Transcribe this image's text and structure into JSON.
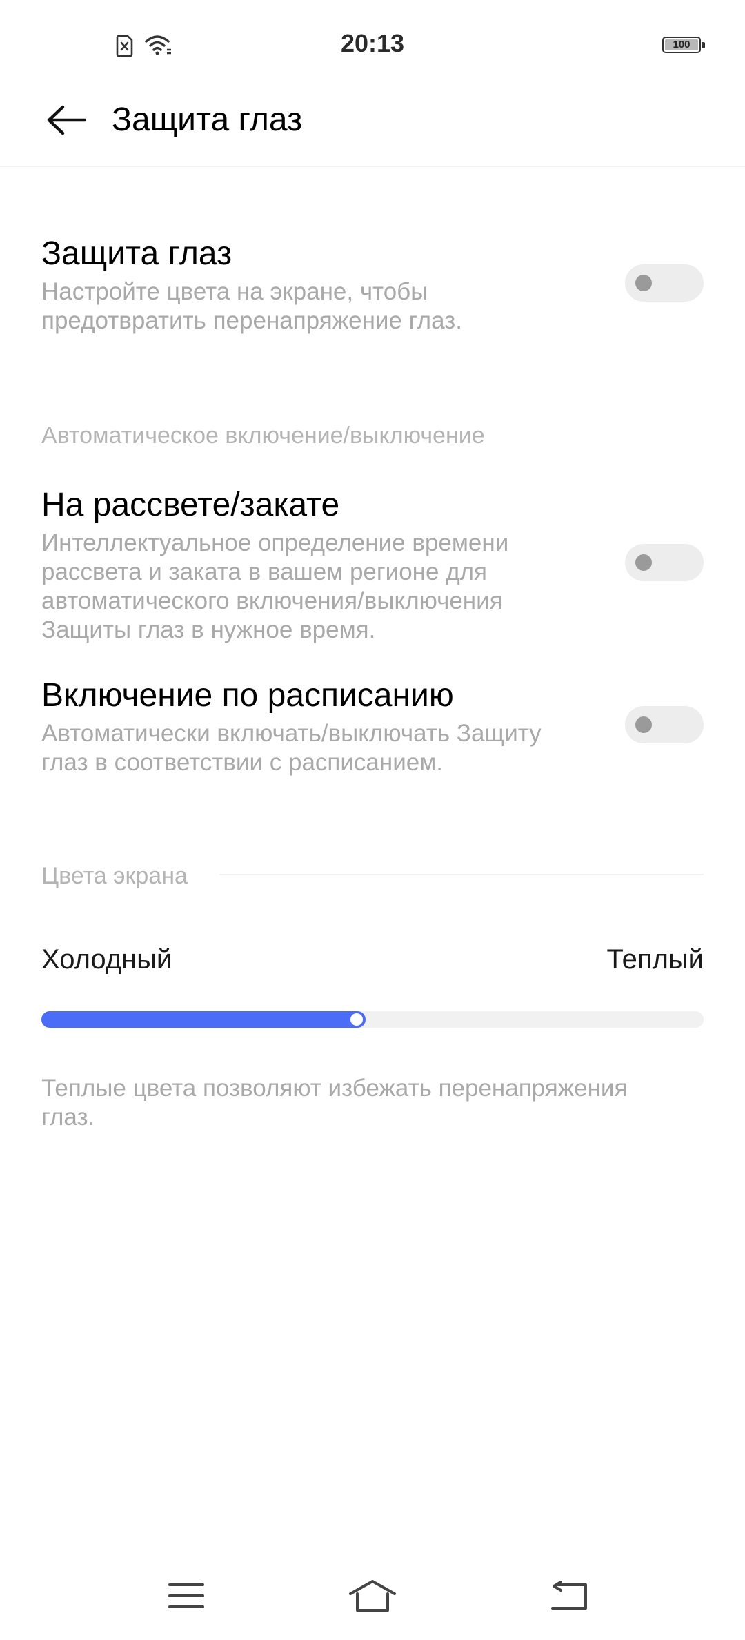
{
  "status_bar": {
    "time": "20:13",
    "battery": "100",
    "icons": [
      "no-sim-icon",
      "wifi-icon",
      "battery-icon"
    ]
  },
  "header": {
    "title": "Защита глаз",
    "back_icon": "arrow-left-icon"
  },
  "eye_protection": {
    "title": "Защита глаз",
    "description_line1": "Настройте цвета на экране, чтобы",
    "description_line2": "предотвратить перенапряжение глаз.",
    "enabled": false
  },
  "auto_section": {
    "header": "Автоматическое включение/выключение",
    "sunrise": {
      "title": "На рассвете/закате",
      "description_line1": "Интеллектуальное определение времени",
      "description_line2": "рассвета и заката в вашем регионе для",
      "description_line3": "автоматического включения/выключения",
      "description_line4": "Защиты глаз в нужное время.",
      "enabled": false
    },
    "schedule": {
      "title": "Включение по расписанию",
      "description_line1": "Автоматически включать/выключать Защиту",
      "description_line2": "глаз в соответствии с расписанием.",
      "enabled": false
    }
  },
  "colors_section": {
    "header": "Цвета экрана",
    "cold_label": "Холодный",
    "warm_label": "Теплый",
    "slider_value": 0.49,
    "hint_line1": "Теплые цвета позволяют избежать перенапряжения",
    "hint_line2": "глаз."
  },
  "nav_bar": {
    "icons": [
      "menu-icon",
      "home-icon",
      "back-icon"
    ]
  },
  "colors": {
    "accent": "#4a6cf6",
    "toggle_off_track": "#ededed",
    "toggle_off_knob": "#9a9a9a",
    "secondary_text": "#a9a9a9"
  }
}
